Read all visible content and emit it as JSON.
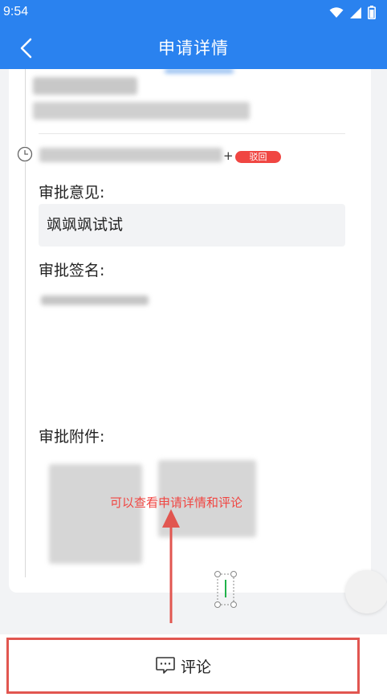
{
  "status_bar": {
    "time": "9:54"
  },
  "app_bar": {
    "title": "申请详情"
  },
  "approval": {
    "status_badge": "驳回",
    "opinion_label": "审批意见:",
    "opinion_text": "飒飒飒试试",
    "signature_label": "审批签名:",
    "attachments_label": "审批附件:"
  },
  "annotation": {
    "hint": "可以查看申请详情和评论"
  },
  "bottom_bar": {
    "comment_label": "评论"
  },
  "colors": {
    "primary": "#2a82ef",
    "reject": "#f04642",
    "annotation": "#e15650"
  },
  "icons": [
    "back-icon",
    "wifi-icon",
    "signal-icon",
    "battery-icon",
    "clock-icon",
    "comment-icon"
  ]
}
